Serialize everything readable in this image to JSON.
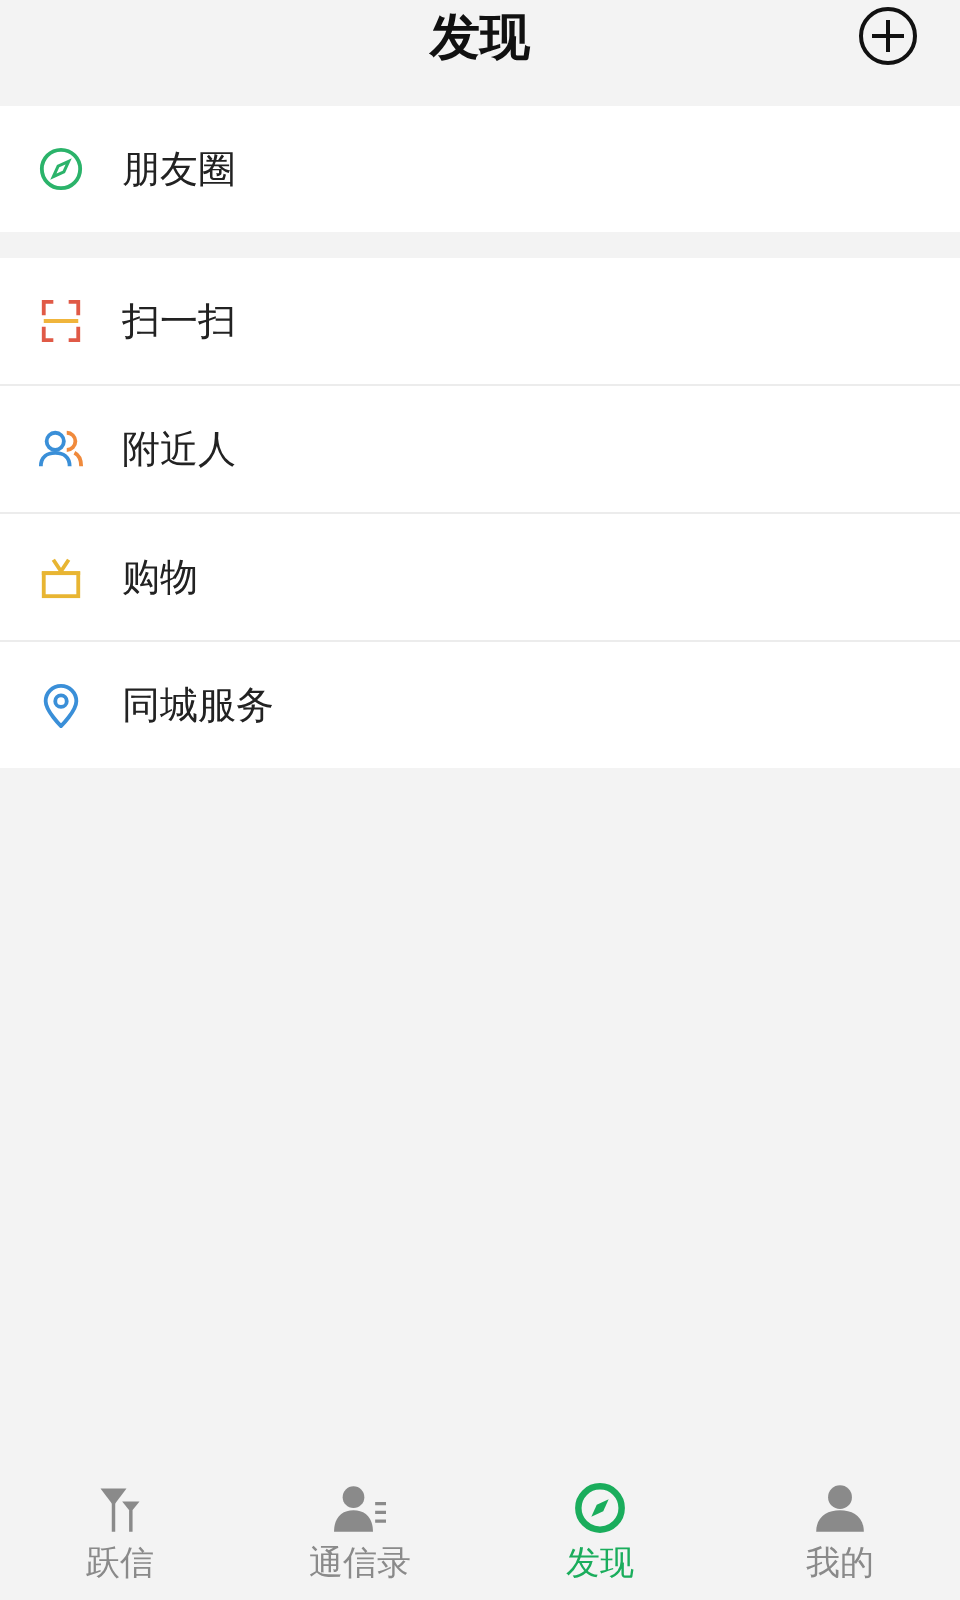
{
  "header": {
    "title": "发现"
  },
  "groups": [
    {
      "items": [
        {
          "label": "朋友圈"
        }
      ]
    },
    {
      "items": [
        {
          "label": "扫一扫"
        },
        {
          "label": "附近人"
        },
        {
          "label": "购物"
        },
        {
          "label": "同城服务"
        }
      ]
    }
  ],
  "tabs": [
    {
      "label": "跃信",
      "selected": false
    },
    {
      "label": "通信录",
      "selected": false
    },
    {
      "label": "发现",
      "selected": true
    },
    {
      "label": "我的",
      "selected": false
    }
  ]
}
